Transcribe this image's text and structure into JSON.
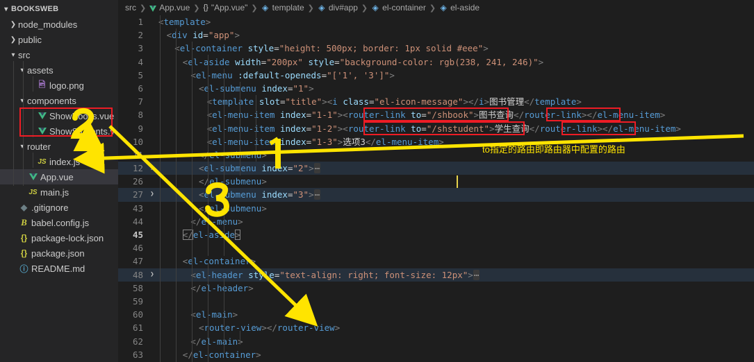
{
  "window": {
    "title": "BOOKSWEB"
  },
  "sidebar": {
    "root_label": "BOOKSWEB",
    "items": [
      {
        "label": "node_modules",
        "icon": "chevron-right-icon",
        "indent": 1,
        "twisty": "›",
        "ftype": "folder"
      },
      {
        "label": "public",
        "icon": "chevron-right-icon",
        "indent": 1,
        "twisty": "›",
        "ftype": "folder"
      },
      {
        "label": "src",
        "icon": "chevron-down-icon",
        "indent": 1,
        "twisty": "⌄",
        "ftype": "folder"
      },
      {
        "label": "assets",
        "icon": "chevron-down-icon",
        "indent": 2,
        "twisty": "⌄",
        "ftype": "folder"
      },
      {
        "label": "logo.png",
        "icon": "image-icon",
        "indent": 3,
        "twisty": "",
        "ftype": "image"
      },
      {
        "label": "components",
        "icon": "chevron-down-icon",
        "indent": 2,
        "twisty": "⌄",
        "ftype": "folder"
      },
      {
        "label": "ShowBooks.vue",
        "icon": "vue-file-icon",
        "indent": 3,
        "twisty": "",
        "ftype": "vue"
      },
      {
        "label": "ShowStudents.vue",
        "icon": "vue-file-icon",
        "indent": 3,
        "twisty": "",
        "ftype": "vue"
      },
      {
        "label": "router",
        "icon": "chevron-down-icon",
        "indent": 2,
        "twisty": "⌄",
        "ftype": "folder"
      },
      {
        "label": "index.js",
        "icon": "js-file-icon",
        "indent": 3,
        "twisty": "",
        "ftype": "js"
      },
      {
        "label": "App.vue",
        "icon": "vue-file-icon",
        "indent": 2,
        "twisty": "",
        "ftype": "vue",
        "selected": true
      },
      {
        "label": "main.js",
        "icon": "js-file-icon",
        "indent": 2,
        "twisty": "",
        "ftype": "js"
      },
      {
        "label": ".gitignore",
        "icon": "git-file-icon",
        "indent": 1,
        "twisty": "",
        "ftype": "git"
      },
      {
        "label": "babel.config.js",
        "icon": "babel-file-icon",
        "indent": 1,
        "twisty": "",
        "ftype": "babel"
      },
      {
        "label": "package-lock.json",
        "icon": "json-file-icon",
        "indent": 1,
        "twisty": "",
        "ftype": "json"
      },
      {
        "label": "package.json",
        "icon": "json-file-icon",
        "indent": 1,
        "twisty": "",
        "ftype": "json"
      },
      {
        "label": "README.md",
        "icon": "markdown-file-icon",
        "indent": 1,
        "twisty": "",
        "ftype": "md"
      }
    ]
  },
  "breadcrumb": {
    "items": [
      {
        "label": "src",
        "icon": ""
      },
      {
        "label": "App.vue",
        "icon": "vue-file-icon"
      },
      {
        "label": "\"App.vue\"",
        "icon": "braces-icon"
      },
      {
        "label": "template",
        "icon": "symbol-field-icon"
      },
      {
        "label": "div#app",
        "icon": "symbol-field-icon"
      },
      {
        "label": "el-container",
        "icon": "symbol-field-icon"
      },
      {
        "label": "el-aside",
        "icon": "symbol-field-icon"
      }
    ],
    "separator": "›"
  },
  "editor": {
    "filename": "App.vue",
    "lines": [
      {
        "n": "1",
        "indent": 0,
        "chev": "",
        "folded": false,
        "tokens": [
          {
            "t": "punc",
            "v": "<"
          },
          {
            "t": "tag",
            "v": "template"
          },
          {
            "t": "punc",
            "v": ">"
          }
        ]
      },
      {
        "n": "2",
        "indent": 1,
        "chev": "",
        "folded": false,
        "tokens": [
          {
            "t": "punc",
            "v": "<"
          },
          {
            "t": "tag",
            "v": "div"
          },
          {
            "t": "txt",
            "v": " "
          },
          {
            "t": "attr",
            "v": "id"
          },
          {
            "t": "eq",
            "v": "="
          },
          {
            "t": "str",
            "v": "\"app\""
          },
          {
            "t": "punc",
            "v": ">"
          }
        ]
      },
      {
        "n": "3",
        "indent": 2,
        "chev": "",
        "folded": false,
        "tokens": [
          {
            "t": "punc",
            "v": "<"
          },
          {
            "t": "tag",
            "v": "el-container"
          },
          {
            "t": "txt",
            "v": " "
          },
          {
            "t": "attr",
            "v": "style"
          },
          {
            "t": "eq",
            "v": "="
          },
          {
            "t": "str",
            "v": "\"height: 500px; border: 1px solid #eee\""
          },
          {
            "t": "punc",
            "v": ">"
          }
        ]
      },
      {
        "n": "4",
        "indent": 3,
        "chev": "",
        "folded": false,
        "tokens": [
          {
            "t": "punc",
            "v": "<"
          },
          {
            "t": "tag",
            "v": "el-aside"
          },
          {
            "t": "txt",
            "v": " "
          },
          {
            "t": "attr",
            "v": "width"
          },
          {
            "t": "eq",
            "v": "="
          },
          {
            "t": "str",
            "v": "\"200px\""
          },
          {
            "t": "txt",
            "v": " "
          },
          {
            "t": "attr",
            "v": "style"
          },
          {
            "t": "eq",
            "v": "="
          },
          {
            "t": "str",
            "v": "\"background-color: rgb(238, 241, 246)\""
          },
          {
            "t": "punc",
            "v": ">"
          }
        ]
      },
      {
        "n": "5",
        "indent": 4,
        "chev": "",
        "folded": false,
        "tokens": [
          {
            "t": "punc",
            "v": "<"
          },
          {
            "t": "tag",
            "v": "el-menu"
          },
          {
            "t": "txt",
            "v": " "
          },
          {
            "t": "attr",
            "v": ":default-openeds"
          },
          {
            "t": "eq",
            "v": "="
          },
          {
            "t": "str",
            "v": "\"['1', '3']\""
          },
          {
            "t": "punc",
            "v": ">"
          }
        ]
      },
      {
        "n": "6",
        "indent": 5,
        "chev": "",
        "folded": false,
        "tokens": [
          {
            "t": "punc",
            "v": "<"
          },
          {
            "t": "tag",
            "v": "el-submenu"
          },
          {
            "t": "txt",
            "v": " "
          },
          {
            "t": "attr",
            "v": "index"
          },
          {
            "t": "eq",
            "v": "="
          },
          {
            "t": "str",
            "v": "\"1\""
          },
          {
            "t": "punc",
            "v": ">"
          }
        ]
      },
      {
        "n": "7",
        "indent": 6,
        "chev": "",
        "folded": false,
        "tokens": [
          {
            "t": "punc",
            "v": "<"
          },
          {
            "t": "tag",
            "v": "template"
          },
          {
            "t": "txt",
            "v": " "
          },
          {
            "t": "attr",
            "v": "slot"
          },
          {
            "t": "eq",
            "v": "="
          },
          {
            "t": "str",
            "v": "\"title\""
          },
          {
            "t": "punc",
            "v": "><"
          },
          {
            "t": "tag",
            "v": "i"
          },
          {
            "t": "txt",
            "v": " "
          },
          {
            "t": "attr",
            "v": "class"
          },
          {
            "t": "eq",
            "v": "="
          },
          {
            "t": "str",
            "v": "\"el-icon-message\""
          },
          {
            "t": "punc",
            "v": "></"
          },
          {
            "t": "tag",
            "v": "i"
          },
          {
            "t": "punc",
            "v": ">"
          },
          {
            "t": "txt",
            "v": "图书管理"
          },
          {
            "t": "punc",
            "v": "</"
          },
          {
            "t": "tag",
            "v": "template"
          },
          {
            "t": "punc",
            "v": ">"
          }
        ]
      },
      {
        "n": "8",
        "indent": 6,
        "chev": "",
        "folded": false,
        "tokens": [
          {
            "t": "punc",
            "v": "<"
          },
          {
            "t": "tag",
            "v": "el-menu-item"
          },
          {
            "t": "txt",
            "v": " "
          },
          {
            "t": "attr",
            "v": "index"
          },
          {
            "t": "eq",
            "v": "="
          },
          {
            "t": "str",
            "v": "\"1-1\""
          },
          {
            "t": "punc",
            "v": "><"
          },
          {
            "t": "tag",
            "v": "router-link"
          },
          {
            "t": "txt",
            "v": " "
          },
          {
            "t": "attr",
            "v": "to"
          },
          {
            "t": "eq",
            "v": "="
          },
          {
            "t": "str",
            "v": "\"/shbook\""
          },
          {
            "t": "punc",
            "v": ">"
          },
          {
            "t": "txt",
            "v": "图书查询"
          },
          {
            "t": "punc",
            "v": "</"
          },
          {
            "t": "tag",
            "v": "router-link"
          },
          {
            "t": "punc",
            "v": "></"
          },
          {
            "t": "tag",
            "v": "el-menu-item"
          },
          {
            "t": "punc",
            "v": ">"
          }
        ]
      },
      {
        "n": "9",
        "indent": 6,
        "chev": "",
        "folded": false,
        "tokens": [
          {
            "t": "punc",
            "v": "<"
          },
          {
            "t": "tag",
            "v": "el-menu-item"
          },
          {
            "t": "txt",
            "v": " "
          },
          {
            "t": "attr",
            "v": "index"
          },
          {
            "t": "eq",
            "v": "="
          },
          {
            "t": "str",
            "v": "\"1-2\""
          },
          {
            "t": "punc",
            "v": "><"
          },
          {
            "t": "tag",
            "v": "router-link"
          },
          {
            "t": "txt",
            "v": " "
          },
          {
            "t": "attr",
            "v": "to"
          },
          {
            "t": "eq",
            "v": "="
          },
          {
            "t": "str",
            "v": "\"/shstudent\""
          },
          {
            "t": "punc",
            "v": ">"
          },
          {
            "t": "txt",
            "v": "学生查询"
          },
          {
            "t": "punc",
            "v": "</"
          },
          {
            "t": "tag",
            "v": "router-link"
          },
          {
            "t": "punc",
            "v": "></"
          },
          {
            "t": "tag",
            "v": "el-menu-item"
          },
          {
            "t": "punc",
            "v": ">"
          }
        ]
      },
      {
        "n": "10",
        "indent": 6,
        "chev": "",
        "folded": false,
        "tokens": [
          {
            "t": "punc",
            "v": "<"
          },
          {
            "t": "tag",
            "v": "el-menu-item"
          },
          {
            "t": "txt",
            "v": " "
          },
          {
            "t": "attr",
            "v": "index"
          },
          {
            "t": "eq",
            "v": "="
          },
          {
            "t": "str",
            "v": "\"1-3\""
          },
          {
            "t": "punc",
            "v": ">"
          },
          {
            "t": "txt",
            "v": "选项3"
          },
          {
            "t": "punc",
            "v": "</"
          },
          {
            "t": "tag",
            "v": "el-menu-item"
          },
          {
            "t": "punc",
            "v": ">"
          }
        ]
      },
      {
        "n": "11",
        "indent": 5,
        "chev": "",
        "folded": false,
        "tokens": [
          {
            "t": "punc",
            "v": "</"
          },
          {
            "t": "tag",
            "v": "el-submenu"
          },
          {
            "t": "punc",
            "v": ">"
          }
        ]
      },
      {
        "n": "12",
        "indent": 5,
        "chev": "›",
        "folded": true,
        "tokens": [
          {
            "t": "punc",
            "v": "<"
          },
          {
            "t": "tag",
            "v": "el-submenu"
          },
          {
            "t": "txt",
            "v": " "
          },
          {
            "t": "attr",
            "v": "index"
          },
          {
            "t": "eq",
            "v": "="
          },
          {
            "t": "str",
            "v": "\"2\""
          },
          {
            "t": "punc",
            "v": ">"
          },
          {
            "t": "fold",
            "v": "⋯"
          }
        ]
      },
      {
        "n": "26",
        "indent": 5,
        "chev": "",
        "folded": false,
        "tokens": [
          {
            "t": "punc",
            "v": "</"
          },
          {
            "t": "tag",
            "v": "el-submenu"
          },
          {
            "t": "punc",
            "v": ">"
          }
        ]
      },
      {
        "n": "27",
        "indent": 5,
        "chev": "›",
        "folded": true,
        "tokens": [
          {
            "t": "punc",
            "v": "<"
          },
          {
            "t": "tag",
            "v": "el-submenu"
          },
          {
            "t": "txt",
            "v": " "
          },
          {
            "t": "attr",
            "v": "index"
          },
          {
            "t": "eq",
            "v": "="
          },
          {
            "t": "str",
            "v": "\"3\""
          },
          {
            "t": "punc",
            "v": ">"
          },
          {
            "t": "fold",
            "v": "⋯"
          }
        ]
      },
      {
        "n": "43",
        "indent": 5,
        "chev": "",
        "folded": false,
        "tokens": [
          {
            "t": "punc",
            "v": "</"
          },
          {
            "t": "tag",
            "v": "el-submenu"
          },
          {
            "t": "punc",
            "v": ">"
          }
        ]
      },
      {
        "n": "44",
        "indent": 4,
        "chev": "",
        "folded": false,
        "tokens": [
          {
            "t": "punc",
            "v": "</"
          },
          {
            "t": "tag",
            "v": "el-menu"
          },
          {
            "t": "punc",
            "v": ">"
          }
        ]
      },
      {
        "n": "45",
        "indent": 3,
        "chev": "",
        "folded": false,
        "current": true,
        "tokens": [
          {
            "t": "punc",
            "v": "</",
            "brk": true
          },
          {
            "t": "tag",
            "v": "el-aside"
          },
          {
            "t": "punc",
            "v": ">",
            "brk": true
          }
        ]
      },
      {
        "n": "46",
        "indent": 0,
        "chev": "",
        "folded": false,
        "tokens": []
      },
      {
        "n": "47",
        "indent": 3,
        "chev": "",
        "folded": false,
        "tokens": [
          {
            "t": "punc",
            "v": "<"
          },
          {
            "t": "tag",
            "v": "el-container"
          },
          {
            "t": "punc",
            "v": ">"
          }
        ]
      },
      {
        "n": "48",
        "indent": 4,
        "chev": "›",
        "folded": true,
        "tokens": [
          {
            "t": "punc",
            "v": "<"
          },
          {
            "t": "tag",
            "v": "el-header"
          },
          {
            "t": "txt",
            "v": " "
          },
          {
            "t": "attr",
            "v": "style"
          },
          {
            "t": "eq",
            "v": "="
          },
          {
            "t": "str",
            "v": "\"text-align: right; font-size: 12px\""
          },
          {
            "t": "punc",
            "v": ">"
          },
          {
            "t": "fold",
            "v": "⋯"
          }
        ]
      },
      {
        "n": "58",
        "indent": 4,
        "chev": "",
        "folded": false,
        "tokens": [
          {
            "t": "punc",
            "v": "</"
          },
          {
            "t": "tag",
            "v": "el-header"
          },
          {
            "t": "punc",
            "v": ">"
          }
        ]
      },
      {
        "n": "59",
        "indent": 0,
        "chev": "",
        "folded": false,
        "tokens": []
      },
      {
        "n": "60",
        "indent": 4,
        "chev": "",
        "folded": false,
        "tokens": [
          {
            "t": "punc",
            "v": "<"
          },
          {
            "t": "tag",
            "v": "el-main"
          },
          {
            "t": "punc",
            "v": ">"
          }
        ]
      },
      {
        "n": "61",
        "indent": 5,
        "chev": "",
        "folded": false,
        "tokens": [
          {
            "t": "punc",
            "v": "<"
          },
          {
            "t": "tag",
            "v": "router-view"
          },
          {
            "t": "punc",
            "v": "></"
          },
          {
            "t": "tag",
            "v": "router-view"
          },
          {
            "t": "punc",
            "v": ">"
          }
        ]
      },
      {
        "n": "62",
        "indent": 4,
        "chev": "",
        "folded": false,
        "tokens": [
          {
            "t": "punc",
            "v": "</"
          },
          {
            "t": "tag",
            "v": "el-main"
          },
          {
            "t": "punc",
            "v": ">"
          }
        ]
      },
      {
        "n": "63",
        "indent": 3,
        "chev": "",
        "folded": false,
        "tokens": [
          {
            "t": "punc",
            "v": "</"
          },
          {
            "t": "tag",
            "v": "el-container"
          },
          {
            "t": "punc",
            "v": ">"
          }
        ]
      }
    ]
  },
  "annotations": {
    "note_text": "to指定的路由即路由器中配置的路由",
    "marker_1": "1",
    "marker_2": "2",
    "marker_3": "3",
    "accent_red": "#ee1c25",
    "accent_yellow": "#ffe400"
  }
}
